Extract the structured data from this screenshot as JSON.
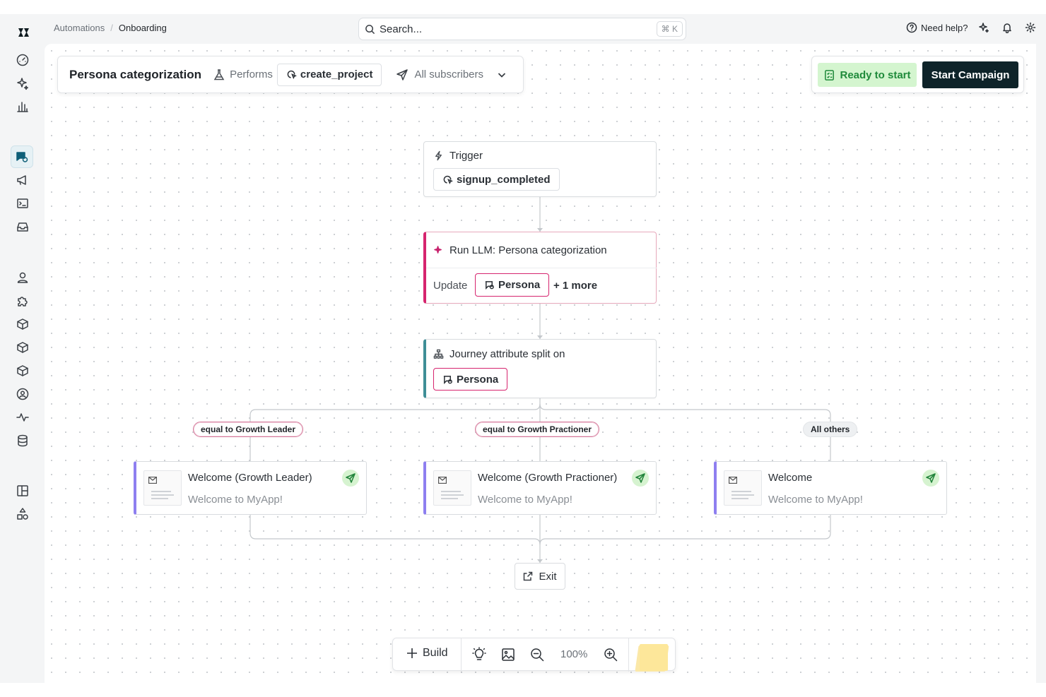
{
  "breadcrumb": {
    "root": "Automations",
    "separator": "/",
    "current": "Onboarding"
  },
  "search": {
    "placeholder": "Search...",
    "shortcut": "⌘ K"
  },
  "header": {
    "help": "Need help?"
  },
  "campaign": {
    "title": "Persona categorization",
    "performs_label": "Performs",
    "event": "create_project",
    "audience": "All subscribers"
  },
  "status": {
    "ready": "Ready to start",
    "start_button": "Start Campaign"
  },
  "flow": {
    "trigger": {
      "title": "Trigger",
      "event": "signup_completed"
    },
    "llm": {
      "title": "Run LLM: Persona categorization",
      "update_label": "Update",
      "attribute": "Persona",
      "more": "+ 1 more"
    },
    "split": {
      "title": "Journey attribute split on",
      "attribute": "Persona"
    },
    "branches": [
      {
        "condition": "equal to Growth Leader",
        "message_title": "Welcome (Growth Leader)",
        "message_subject": "Welcome to MyApp!"
      },
      {
        "condition": "equal to Growth Practioner",
        "message_title": "Welcome (Growth Practioner)",
        "message_subject": "Welcome to MyApp!"
      },
      {
        "condition": "All others",
        "message_title": "Welcome",
        "message_subject": "Welcome to MyApp!"
      }
    ],
    "exit": "Exit"
  },
  "bottom_bar": {
    "build": "Build",
    "zoom": "100%"
  },
  "colors": {
    "llm_accent": "#d6246e",
    "split_accent": "#3e8e96",
    "message_accent": "#8e7ff0",
    "ready_bg": "#d4f5cf",
    "start_bg": "#0e2329"
  }
}
